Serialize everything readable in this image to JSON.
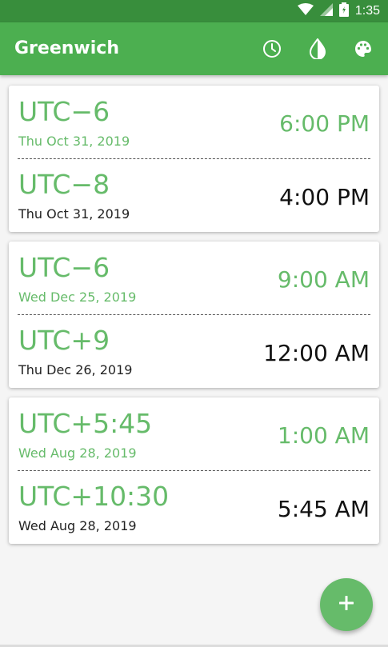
{
  "status_bar": {
    "time": "1:35",
    "icons": [
      "wifi-icon",
      "signal-icon",
      "battery-icon"
    ]
  },
  "app_bar": {
    "title": "Greenwich",
    "actions": [
      "clock-icon",
      "contrast-icon",
      "palette-icon"
    ],
    "color": "#4caf50"
  },
  "colors": {
    "accent": "#66bb6a",
    "status_bar": "#388e3c"
  },
  "cards": [
    {
      "from": {
        "offset": "UTC−6",
        "date": "Thu Oct 31, 2019",
        "time": "6:00 PM"
      },
      "to": {
        "offset": "UTC−8",
        "date": "Thu Oct 31, 2019",
        "time": "4:00 PM"
      }
    },
    {
      "from": {
        "offset": "UTC−6",
        "date": "Wed Dec 25, 2019",
        "time": "9:00 AM"
      },
      "to": {
        "offset": "UTC+9",
        "date": "Thu Dec 26, 2019",
        "time": "12:00 AM"
      }
    },
    {
      "from": {
        "offset": "UTC+5:45",
        "date": "Wed Aug 28, 2019",
        "time": "1:00 AM"
      },
      "to": {
        "offset": "UTC+10:30",
        "date": "Wed Aug 28, 2019",
        "time": "5:45 AM"
      }
    }
  ],
  "fab": {
    "icon": "plus-icon"
  }
}
